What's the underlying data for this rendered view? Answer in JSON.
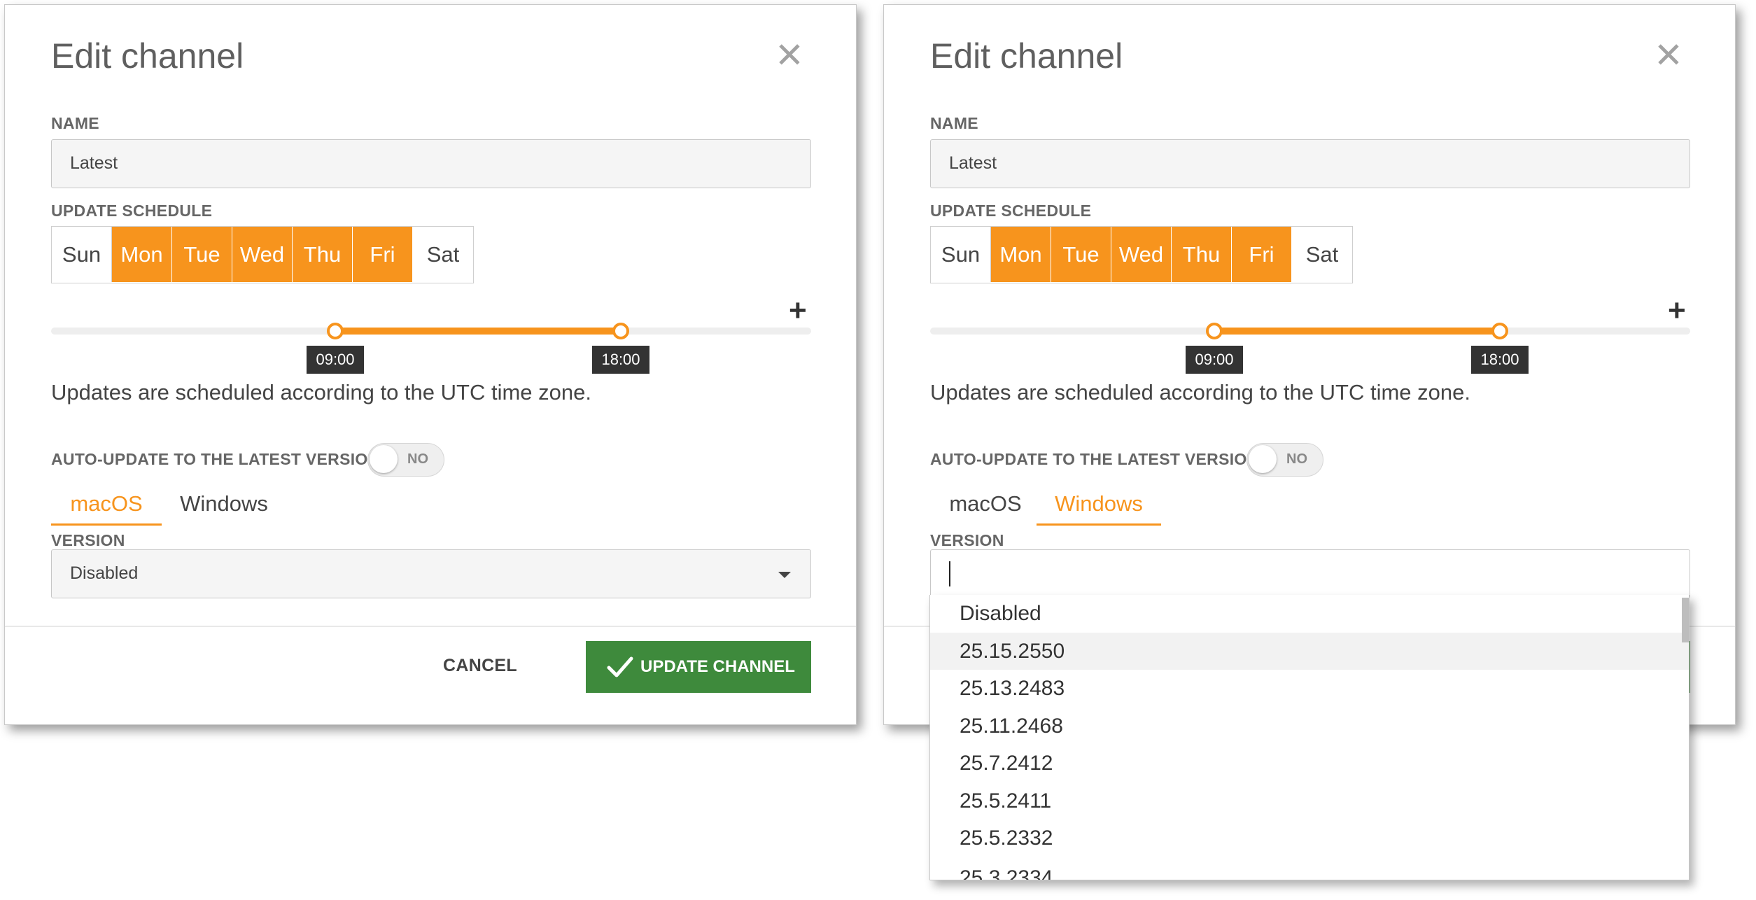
{
  "dialog_left": {
    "title": "Edit channel",
    "close_glyph": "✕",
    "name_label": "NAME",
    "name_value": "Latest",
    "schedule_label": "UPDATE SCHEDULE",
    "days": [
      {
        "label": "Sun",
        "selected": false
      },
      {
        "label": "Mon",
        "selected": true
      },
      {
        "label": "Tue",
        "selected": true
      },
      {
        "label": "Wed",
        "selected": true
      },
      {
        "label": "Thu",
        "selected": true
      },
      {
        "label": "Fri",
        "selected": true
      },
      {
        "label": "Sat",
        "selected": false
      }
    ],
    "add_glyph": "+",
    "start_time": "09:00",
    "end_time": "18:00",
    "timezone_note": "Updates are scheduled according to the UTC time zone.",
    "auto_update_label": "AUTO-UPDATE TO THE LATEST VERSION",
    "auto_update_state": "NO",
    "tabs": [
      "macOS",
      "Windows"
    ],
    "active_tab": "macOS",
    "version_label": "VERSION",
    "version_value": "Disabled",
    "cancel_label": "CANCEL",
    "submit_label": "UPDATE CHANNEL"
  },
  "dialog_right": {
    "title": "Edit channel",
    "close_glyph": "✕",
    "name_label": "NAME",
    "name_value": "Latest",
    "schedule_label": "UPDATE SCHEDULE",
    "days": [
      {
        "label": "Sun",
        "selected": false
      },
      {
        "label": "Mon",
        "selected": true
      },
      {
        "label": "Tue",
        "selected": true
      },
      {
        "label": "Wed",
        "selected": true
      },
      {
        "label": "Thu",
        "selected": true
      },
      {
        "label": "Fri",
        "selected": true
      },
      {
        "label": "Sat",
        "selected": false
      }
    ],
    "add_glyph": "+",
    "start_time": "09:00",
    "end_time": "18:00",
    "timezone_note": "Updates are scheduled according to the UTC time zone.",
    "auto_update_label": "AUTO-UPDATE TO THE LATEST VERSION",
    "auto_update_state": "NO",
    "tabs": [
      "macOS",
      "Windows"
    ],
    "active_tab": "Windows",
    "version_label": "VERSION",
    "version_options": [
      "Disabled",
      "25.15.2550",
      "25.13.2483",
      "25.11.2468",
      "25.7.2412",
      "25.5.2411",
      "25.5.2332"
    ],
    "highlighted_option": "25.15.2550"
  },
  "colors": {
    "accent_orange": "#f7941d",
    "primary_green": "#3e8a3c",
    "time_label_bg": "#333333"
  },
  "icons": {
    "close": "close-icon",
    "add": "plus-icon",
    "dropdown": "caret-down-icon",
    "confirm": "check-icon"
  }
}
